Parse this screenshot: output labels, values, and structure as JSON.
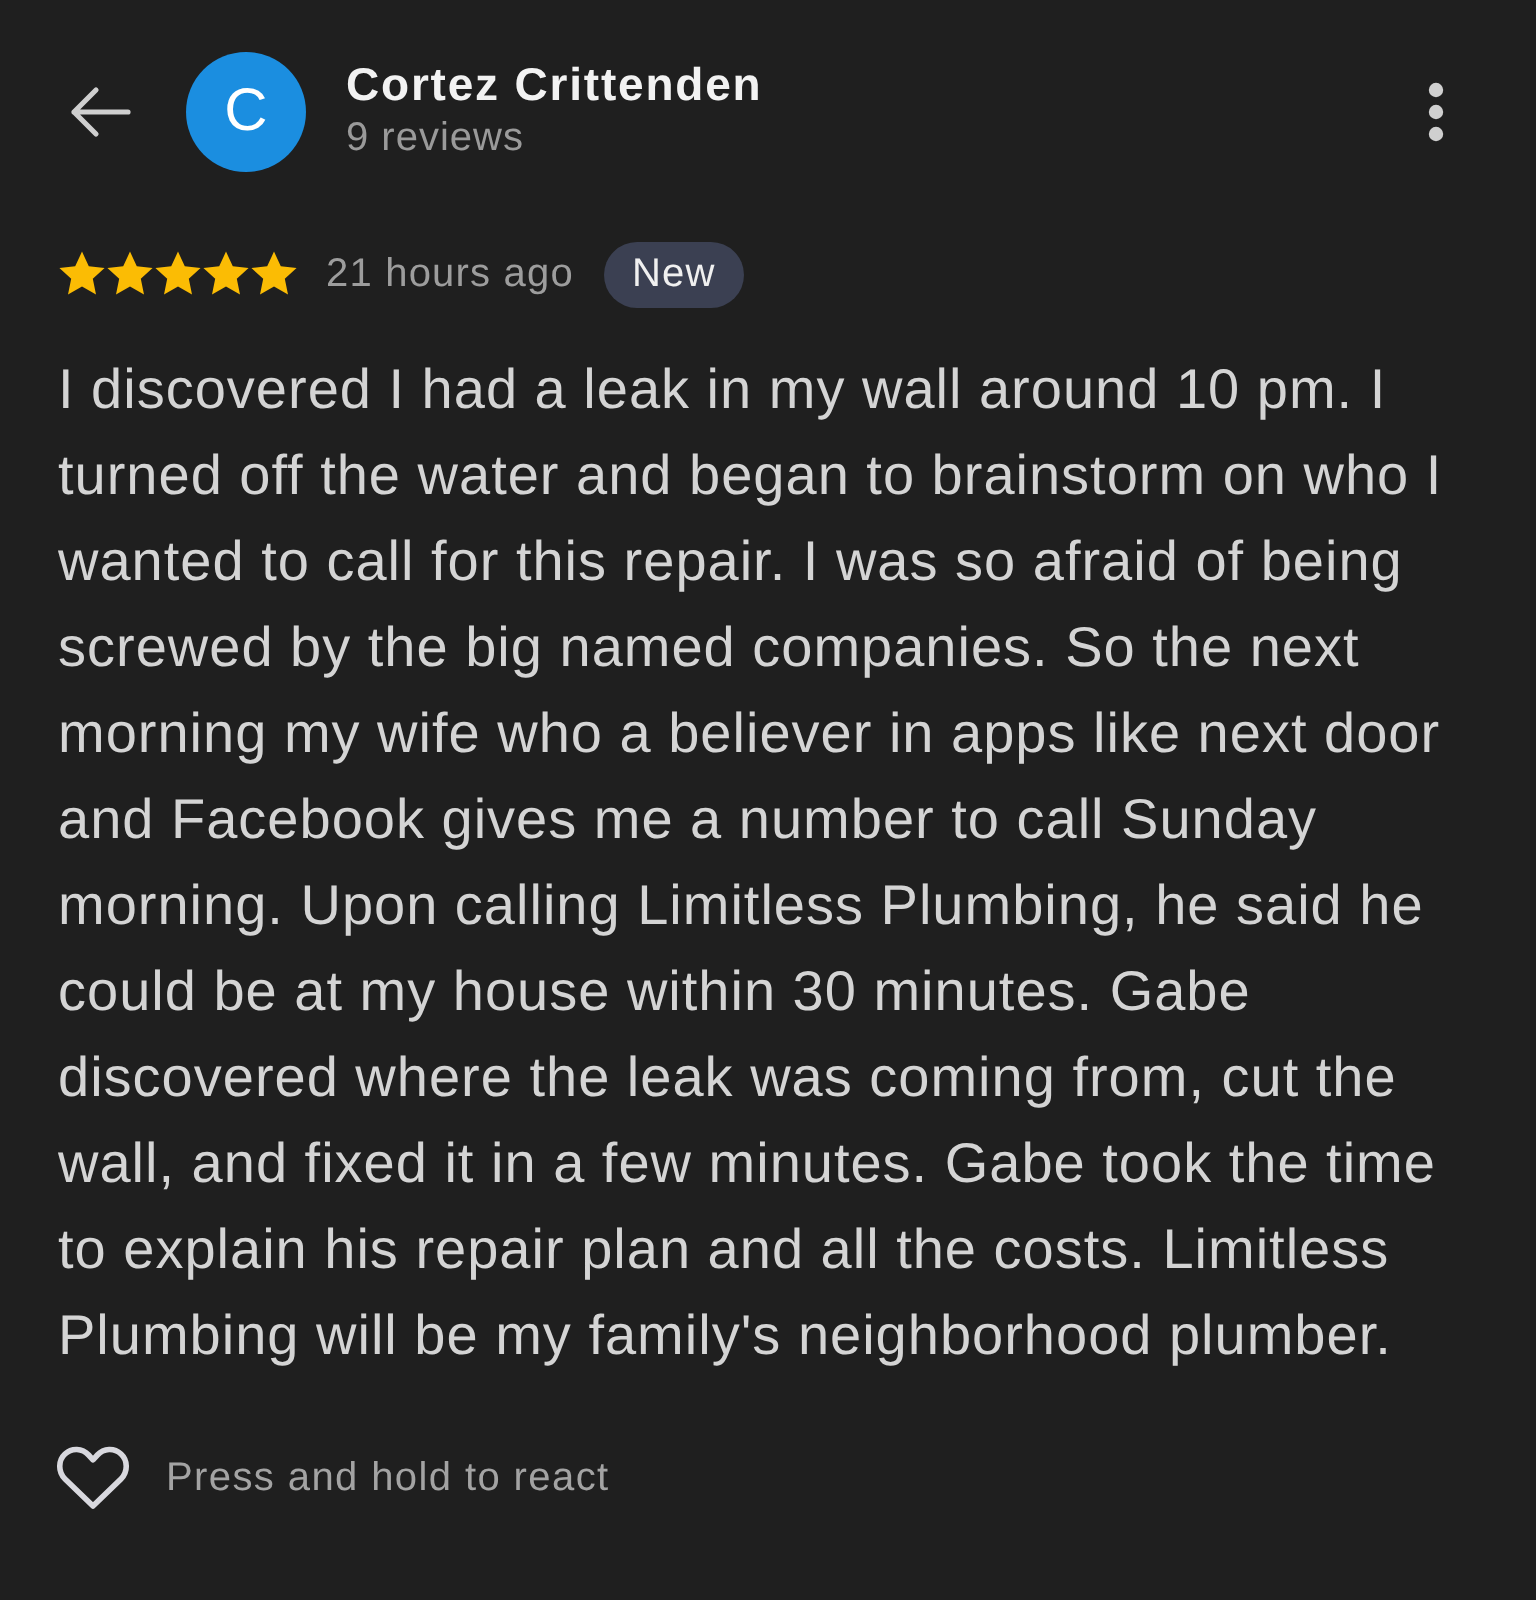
{
  "header": {
    "avatar_letter": "C",
    "name": "Cortez Crittenden",
    "review_count": "9 reviews"
  },
  "review": {
    "stars": 5,
    "time": "21 hours ago",
    "badge": "New",
    "text": "I discovered I had a leak in my wall around 10 pm. I turned off the water and began to brainstorm on who I wanted to call for this repair. I was so afraid of being screwed by the big named companies. So the next morning my wife who a believer in apps like next door and Facebook gives me a number to call Sunday morning. Upon calling Limitless Plumbing, he said he could be at my house within 30 minutes. Gabe discovered where the leak was coming from, cut the wall, and fixed it in a few minutes. Gabe took the time to explain his repair plan and all the costs. Limitless Plumbing will be my family's neighborhood plumber."
  },
  "footer": {
    "hint": "Press and hold to react"
  }
}
